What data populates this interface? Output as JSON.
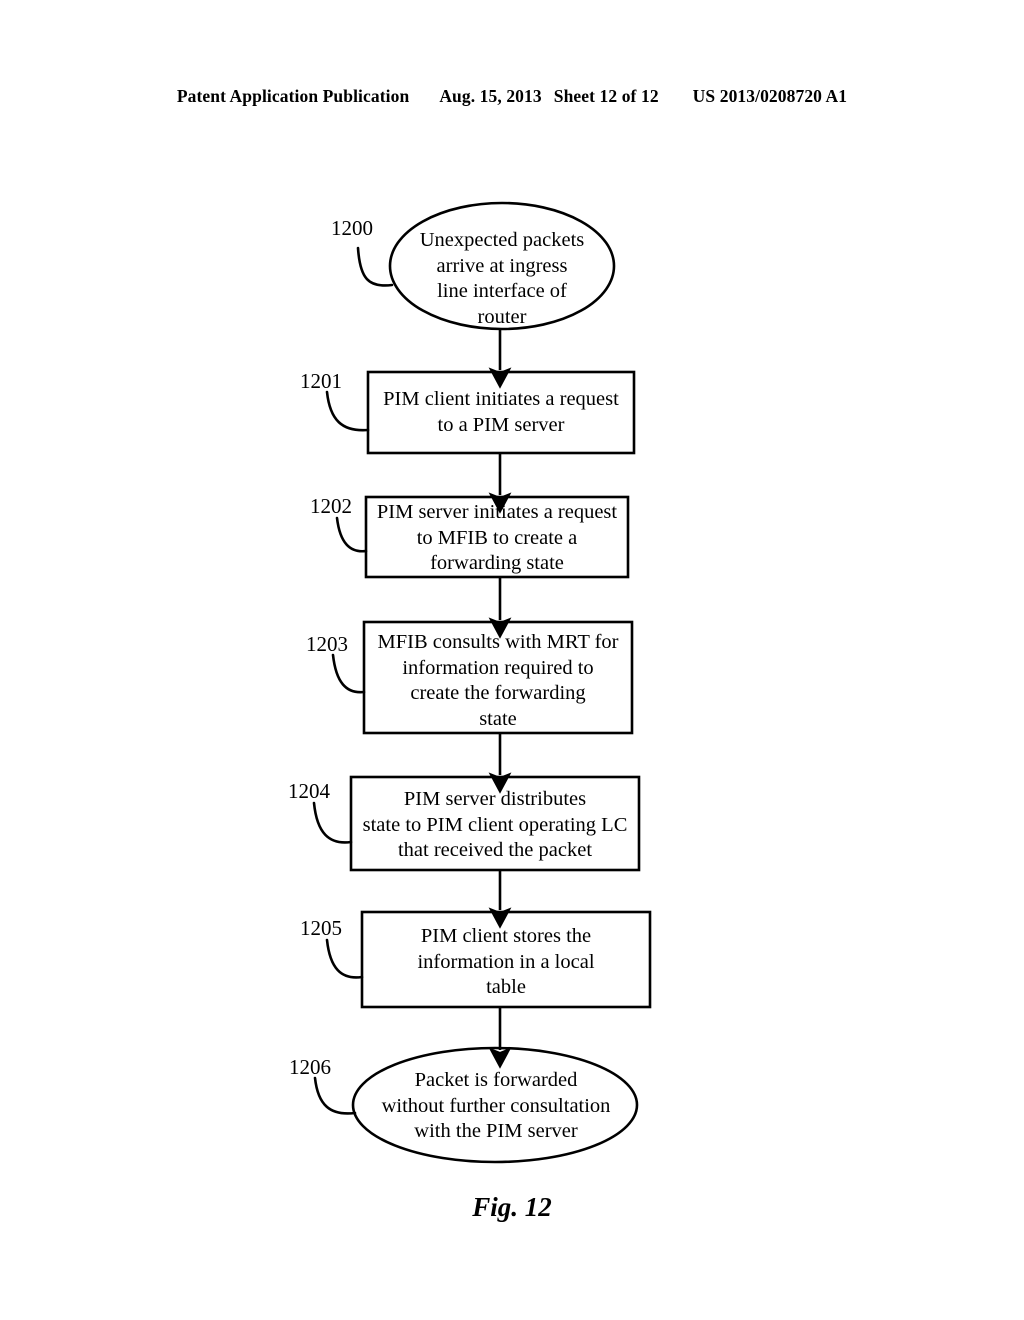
{
  "header": {
    "publication": "Patent Application Publication",
    "date": "Aug. 15, 2013",
    "sheet": "Sheet 12 of 12",
    "patent_number": "US 2013/0208720 A1"
  },
  "figure": {
    "caption": "Fig. 12",
    "nodes": [
      {
        "ref": "1200",
        "shape": "ellipse",
        "text": "Unexpected packets\narrive at ingress\nline interface of\nrouter"
      },
      {
        "ref": "1201",
        "shape": "rect",
        "text": "PIM client initiates a request\nto a PIM server"
      },
      {
        "ref": "1202",
        "shape": "rect",
        "text": "PIM server initiates a request\nto MFIB to create a\nforwarding state"
      },
      {
        "ref": "1203",
        "shape": "rect",
        "text": "MFIB consults with MRT for\ninformation required to\ncreate the forwarding\nstate"
      },
      {
        "ref": "1204",
        "shape": "rect",
        "text": "PIM server distributes\nstate to PIM client operating LC\nthat received the packet"
      },
      {
        "ref": "1205",
        "shape": "rect",
        "text": "PIM client stores the\ninformation in a local\ntable"
      },
      {
        "ref": "1206",
        "shape": "ellipse",
        "text": "Packet is forwarded\nwithout further consultation\nwith the PIM server"
      }
    ]
  },
  "colors": {
    "ink": "#000000",
    "paper": "#ffffff"
  }
}
